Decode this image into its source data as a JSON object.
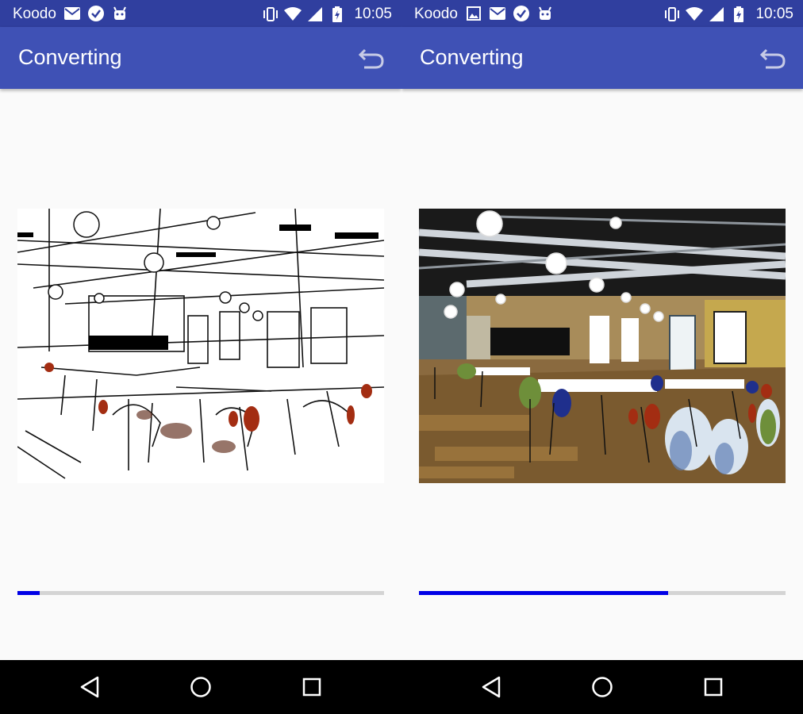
{
  "screens": [
    {
      "status": {
        "carrier": "Koodo",
        "time": "10:05",
        "left_icons": [
          "mail-icon",
          "check-circle-icon",
          "android-icon"
        ],
        "right_icons": [
          "vibrate-icon",
          "wifi-icon",
          "signal-icon",
          "battery-charging-icon"
        ]
      },
      "appbar": {
        "title": "Converting",
        "action_icon": "undo-icon"
      },
      "image": {
        "style": "sketch",
        "subject": "cafeteria interior"
      },
      "progress": {
        "value": 0.06
      }
    },
    {
      "status": {
        "carrier": "Koodo",
        "time": "10:05",
        "left_icons": [
          "image-icon",
          "mail-icon",
          "check-circle-icon",
          "android-icon"
        ],
        "right_icons": [
          "vibrate-icon",
          "wifi-icon",
          "signal-icon",
          "battery-charging-icon"
        ]
      },
      "appbar": {
        "title": "Converting",
        "action_icon": "undo-icon"
      },
      "image": {
        "style": "posterized color",
        "subject": "cafeteria interior"
      },
      "progress": {
        "value": 0.68
      }
    }
  ],
  "colors": {
    "statusbar": "#303f9f",
    "appbar": "#3f51b5",
    "progress_fill": "#0000e6",
    "progress_track": "#d4d4d4"
  },
  "navbar": {
    "icons": [
      "back-icon",
      "home-icon",
      "recents-icon"
    ]
  }
}
